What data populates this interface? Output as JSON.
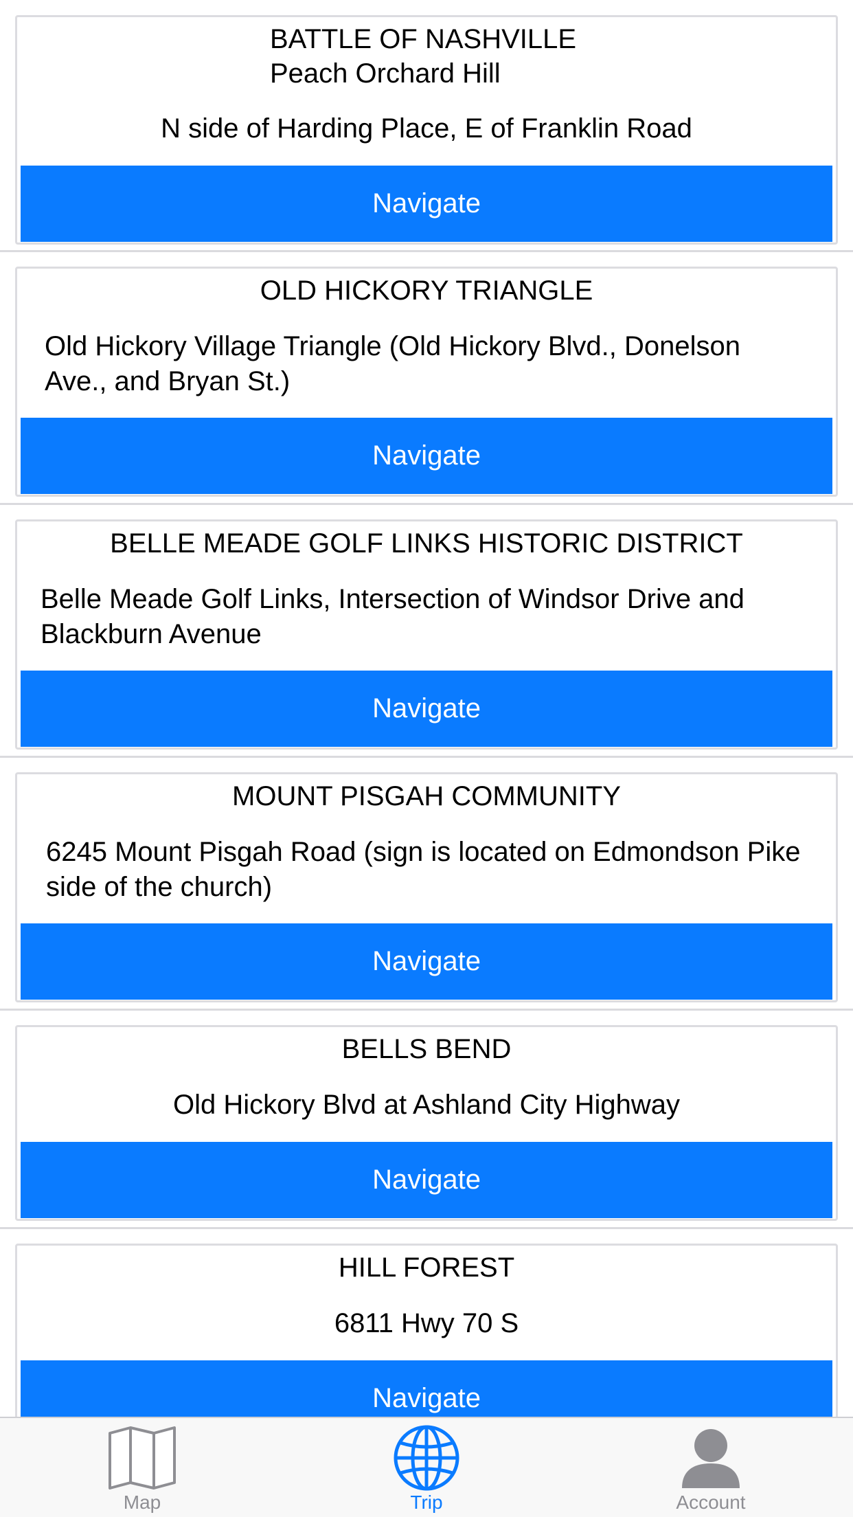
{
  "locations": [
    {
      "title": "BATTLE OF NASHVILLE",
      "subtitle": "Peach Orchard Hill",
      "address": "N side of Harding Place, E of Franklin Road",
      "button_label": "Navigate"
    },
    {
      "title": "OLD HICKORY TRIANGLE",
      "address": "Old Hickory Village Triangle (Old Hickory Blvd., Donelson Ave., and Bryan St.)",
      "button_label": "Navigate"
    },
    {
      "title": "BELLE MEADE GOLF LINKS HISTORIC DISTRICT",
      "address": "Belle Meade Golf Links, Intersection of Windsor Drive and Blackburn Avenue",
      "button_label": "Navigate"
    },
    {
      "title": "MOUNT PISGAH COMMUNITY",
      "address": "6245 Mount Pisgah Road (sign is located on Edmondson Pike side of the church)",
      "button_label": "Navigate"
    },
    {
      "title": "BELLS BEND",
      "address": "Old Hickory Blvd at Ashland City Highway",
      "button_label": "Navigate"
    },
    {
      "title": "HILL FOREST",
      "address": "6811 Hwy 70 S",
      "button_label": "Navigate"
    }
  ],
  "tabbar": {
    "tabs": [
      {
        "label": "Map",
        "icon": "map-icon",
        "selected": false
      },
      {
        "label": "Trip",
        "icon": "globe-icon",
        "selected": true
      },
      {
        "label": "Account",
        "icon": "person-icon",
        "selected": false
      }
    ],
    "active_color": "#0a7bff",
    "inactive_color": "#8e8e93"
  },
  "colors": {
    "button": "#0a7bff",
    "button_text": "#ffffff"
  }
}
